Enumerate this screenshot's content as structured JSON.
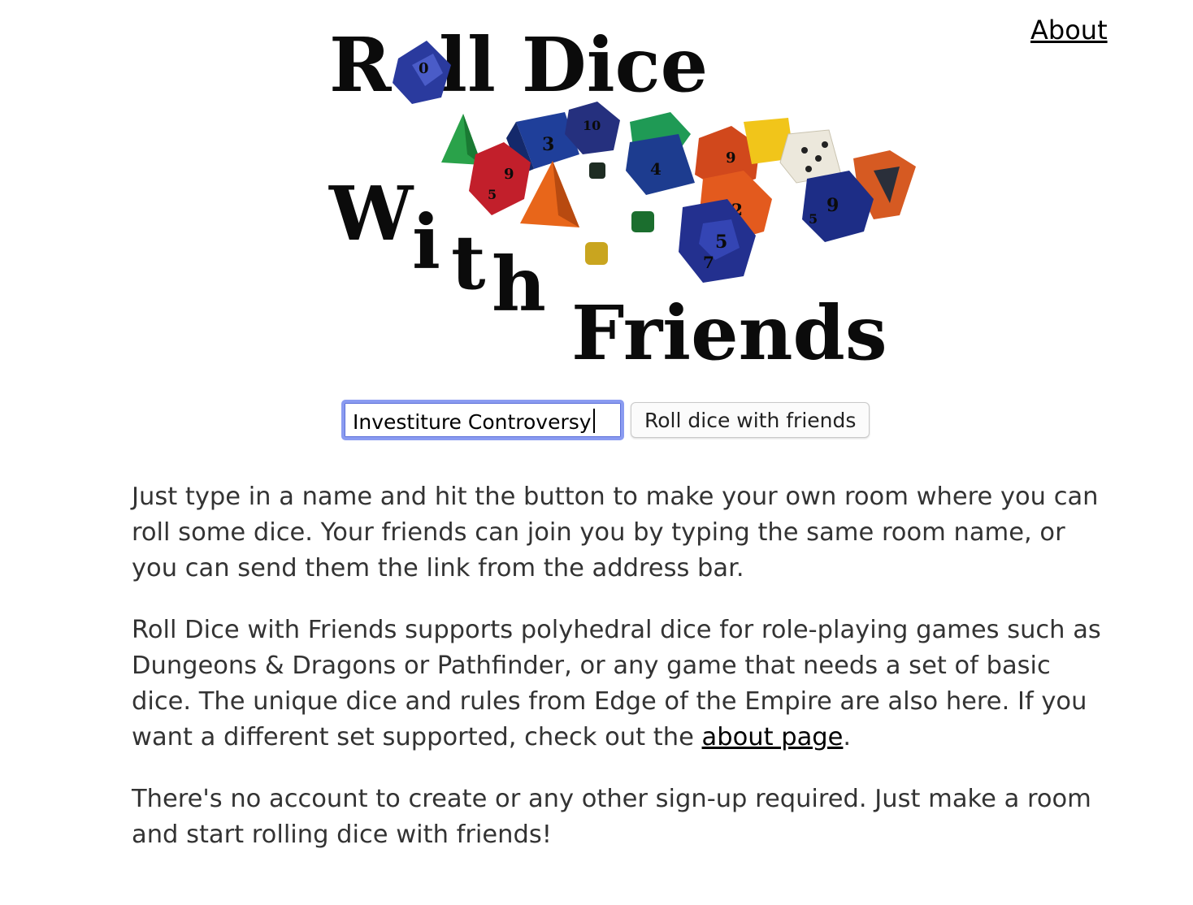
{
  "nav": {
    "about_label": "About"
  },
  "logo": {
    "line1a": "R",
    "line1b": "ll Dice",
    "line2": [
      "W",
      "i",
      "t",
      "h"
    ],
    "line3": "Friends"
  },
  "form": {
    "room_input_value": "Investiture Controversy",
    "roll_button_label": "Roll dice with friends"
  },
  "content": {
    "para1": "Just type in a name and hit the button to make your own room where you can roll some dice. Your friends can join you by typing the same room name, or you can send them the link from the address bar.",
    "para2_before_link": "Roll Dice with Friends supports polyhedral dice for role-playing games such as Dungeons & Dragons or Pathfinder, or any game that needs a set of basic dice. The unique dice and rules from Edge of the Empire are also here. If you want a different set supported, check out the ",
    "para2_link": "about page",
    "para2_after_link": ".",
    "para3": "There's no account to create or any other sign-up required. Just make a room and start rolling dice with friends!"
  },
  "colors": {
    "input_focus_border": "#8a9bf1",
    "text": "#333333",
    "link": "#000000"
  }
}
